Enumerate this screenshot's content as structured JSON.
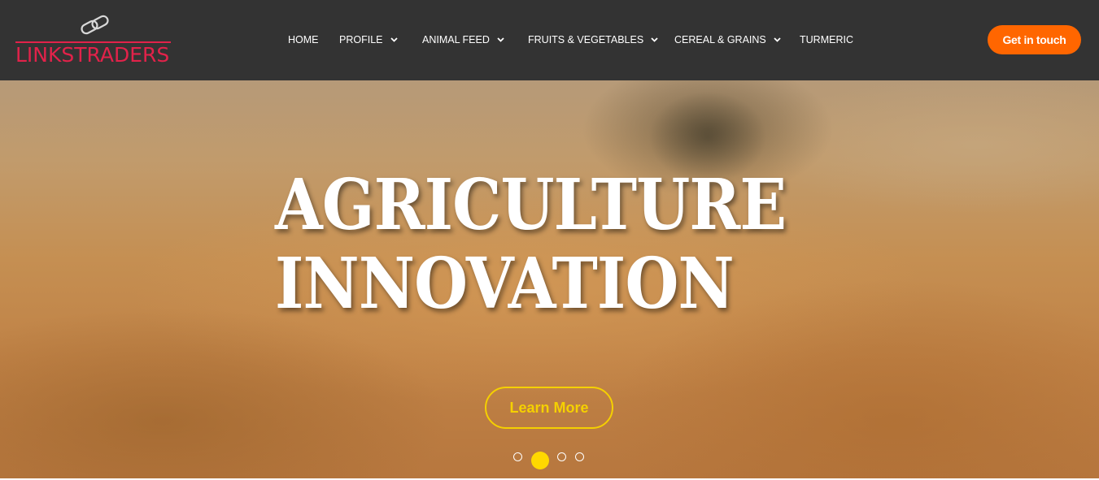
{
  "brand": {
    "name": "LINKSTRADERS",
    "accent": "#e2224a"
  },
  "nav": {
    "items": [
      {
        "label": "HOME",
        "dropdown": false
      },
      {
        "label": "PROFILE",
        "dropdown": true
      },
      {
        "label": "ANIMAL FEED",
        "dropdown": true
      },
      {
        "label": "FRUITS & VEGETABLES",
        "dropdown": true
      },
      {
        "label": "CEREAL & GRAINS",
        "dropdown": true
      },
      {
        "label": "TURMERIC",
        "dropdown": false
      }
    ]
  },
  "cta": {
    "label": "Get in touch",
    "color": "#ff6600"
  },
  "hero": {
    "title_line1": "AGRICULTURE",
    "title_line2": "INNOVATION",
    "button_label": "Learn More",
    "button_color": "#f5d000",
    "slides_total": 4,
    "active_slide": 2
  },
  "icons": [
    "chain-link-icon",
    "chevron-down-icon"
  ]
}
